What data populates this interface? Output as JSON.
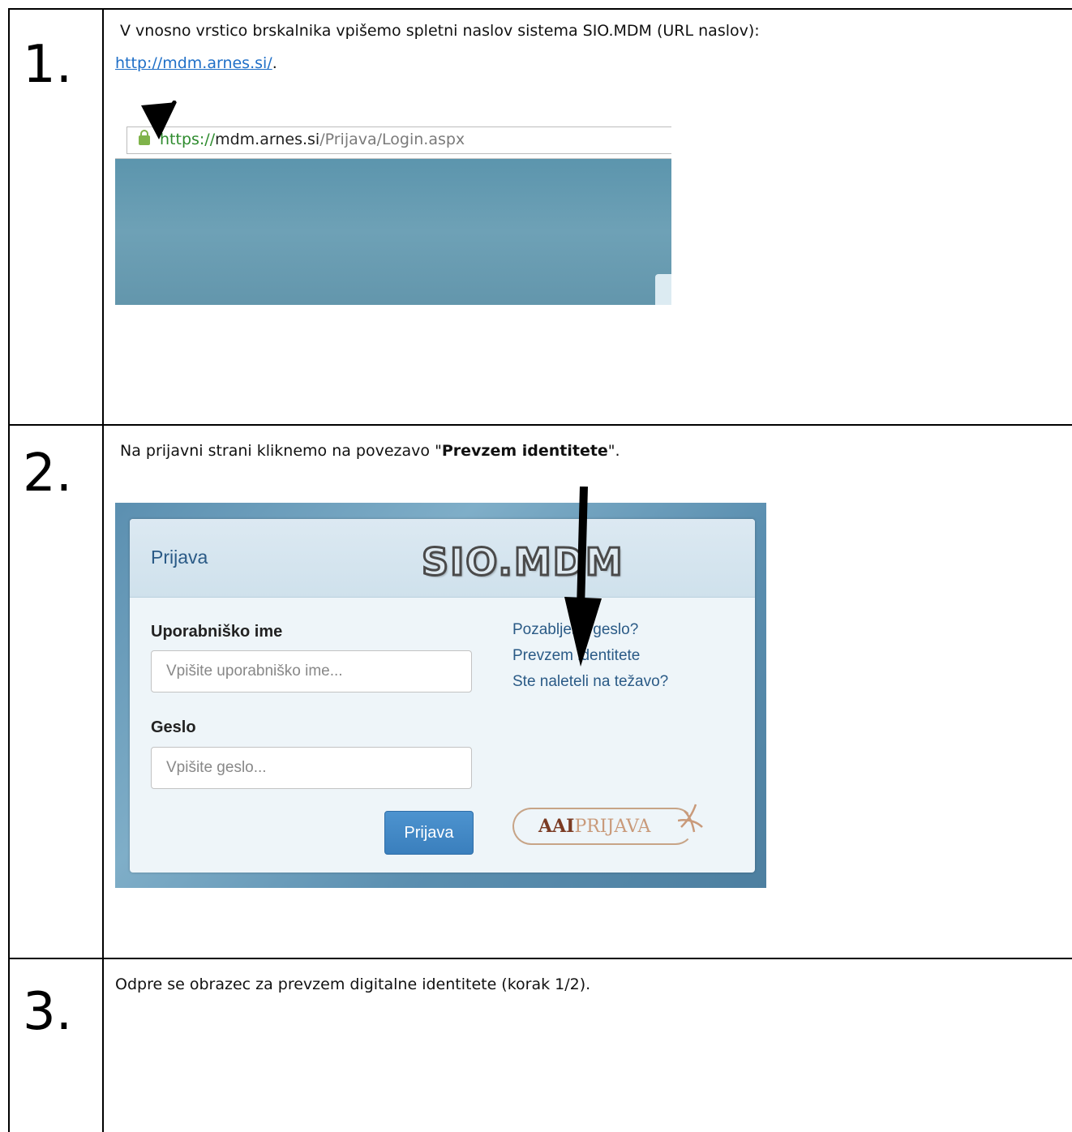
{
  "steps": [
    {
      "number": "1.",
      "text_before_link": "V vnosno vrstico brskalnika vpišemo spletni naslov sistema SIO.MDM (URL naslov):",
      "link": "http://mdm.arnes.si/",
      "text_after_link": ".",
      "browser": {
        "url_scheme": "https://",
        "url_host": "mdm.arnes.si",
        "url_path": "/Prijava/Login.aspx"
      }
    },
    {
      "number": "2.",
      "text_before": "Na prijavni strani kliknemo na povezavo \"",
      "text_bold": "Prevzem identitete",
      "text_after": "\".",
      "login": {
        "title": "Prijava",
        "logo": "SIO.MDM",
        "username_label": "Uporabniško ime",
        "username_placeholder": "Vpišite uporabniško ime...",
        "password_label": "Geslo",
        "password_placeholder": "Vpišite geslo...",
        "submit_label": "Prijava",
        "links": [
          "Pozabljeno geslo?",
          "Prevzem identitete",
          "Ste naleteli na težavo?"
        ],
        "aai_strong": "AAI",
        "aai_light": "PRIJAVA"
      }
    },
    {
      "number": "3.",
      "text": "Odpre se obrazec za prevzem digitalne identitete (korak 1/2)."
    }
  ],
  "colors": {
    "link": "#1f6fc7",
    "url_scheme": "#2e8b2e",
    "panel_title": "#2a5a86",
    "submit_button": "#3a7fbd"
  }
}
